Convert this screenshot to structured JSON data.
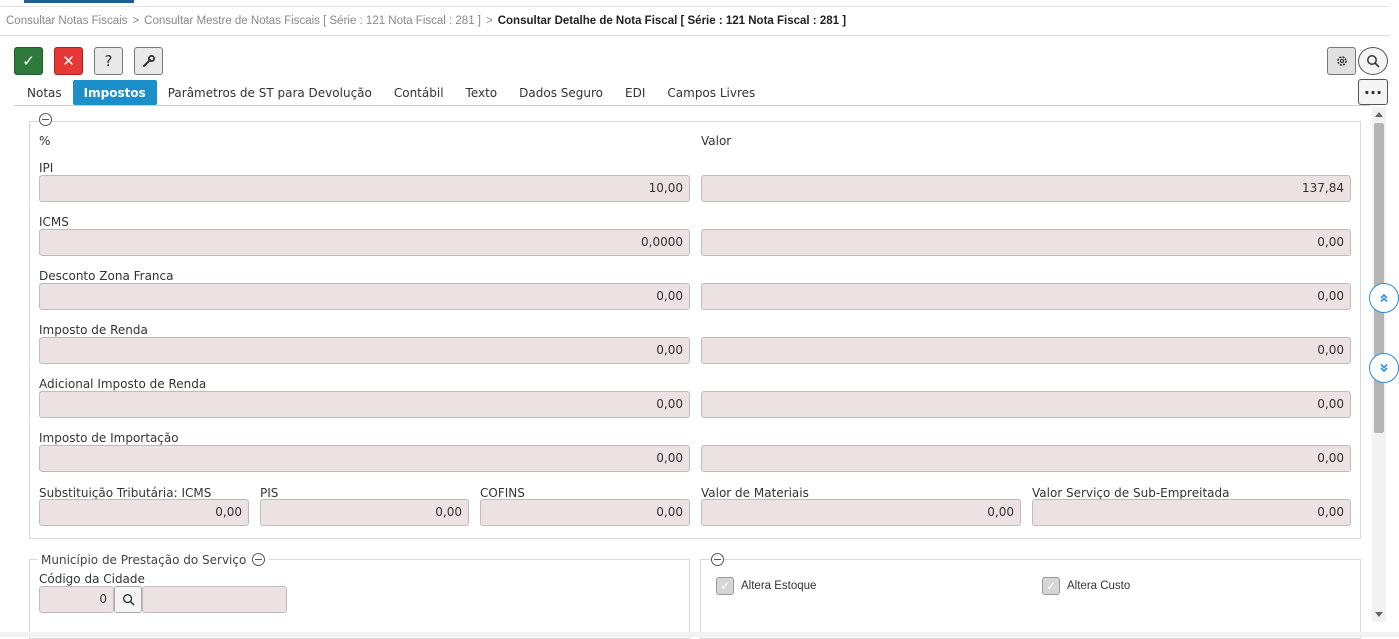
{
  "breadcrumb": [
    "Consultar Notas Fiscais",
    "Consultar Mestre de Notas Fiscais [ Série : 121 Nota Fiscal : 281 ]",
    "Consultar Detalhe de Nota Fiscal [ Série : 121 Nota Fiscal : 281 ]"
  ],
  "breadcrumb_separator": ">",
  "toolbar": {
    "ok": "✓",
    "cancel": "✕",
    "help": "?",
    "more": "..."
  },
  "tabs": [
    "Notas",
    "Impostos",
    "Parâmetros de ST para Devolução",
    "Contábil",
    "Texto",
    "Dados Seguro",
    "EDI",
    "Campos Livres"
  ],
  "active_tab": "Impostos",
  "section_main": {
    "col_percent": "%",
    "col_value": "Valor",
    "rows": [
      {
        "label": "IPI",
        "percent": "10,00",
        "value": "137,84"
      },
      {
        "label": "ICMS",
        "percent": "0,0000",
        "value": "0,00"
      },
      {
        "label": "Desconto Zona Franca",
        "percent": "0,00",
        "value": "0,00"
      },
      {
        "label": "Imposto de Renda",
        "percent": "0,00",
        "value": "0,00"
      },
      {
        "label": "Adicional Imposto de Renda",
        "percent": "0,00",
        "value": "0,00"
      },
      {
        "label": "Imposto de Importação",
        "percent": "0,00",
        "value": "0,00"
      }
    ],
    "bottom_row": [
      {
        "label": "Substituição Tributária: ICMS",
        "value": "0,00"
      },
      {
        "label": "PIS",
        "value": "0,00"
      },
      {
        "label": "COFINS",
        "value": "0,00"
      },
      {
        "label": "Valor de Materiais",
        "value": "0,00"
      },
      {
        "label": "Valor Serviço de Sub-Empreitada",
        "value": "0,00"
      }
    ]
  },
  "municipio": {
    "title": "Município de Prestação do Serviço",
    "codigo_label": "Código da Cidade",
    "codigo_value": "0",
    "cidade_name": ""
  },
  "checkboxes": [
    {
      "label": "Altera Estoque",
      "checked": true
    },
    {
      "label": "Altera Custo",
      "checked": true
    }
  ],
  "colors": {
    "accent_tab": "#1a8fc9",
    "ok": "#2d7a3c",
    "cancel": "#e53935",
    "field_bg": "#ece1e3",
    "jump_button": "#2a8ed4"
  }
}
